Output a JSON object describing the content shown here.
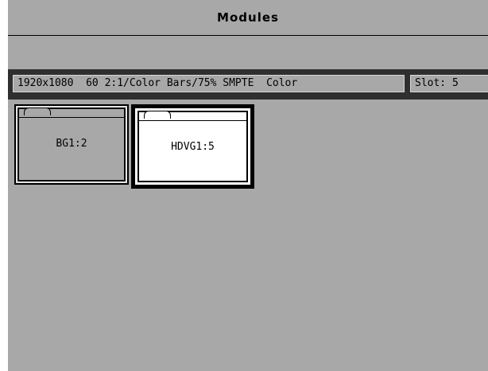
{
  "window": {
    "title": "Modules"
  },
  "status": {
    "format": "1920x1080  60 2:1/Color Bars/75% SMPTE  Color",
    "slot": "Slot: 5"
  },
  "modules": [
    {
      "label": "BG1:2",
      "selected": false
    },
    {
      "label": "HDVG1:5",
      "selected": true
    }
  ],
  "colors": {
    "panel": "#a8a8a8",
    "status_bar": "#2f2f2f",
    "selected_module": "#ffffff",
    "border": "#000000"
  },
  "icons": {
    "module": "folder-icon"
  }
}
